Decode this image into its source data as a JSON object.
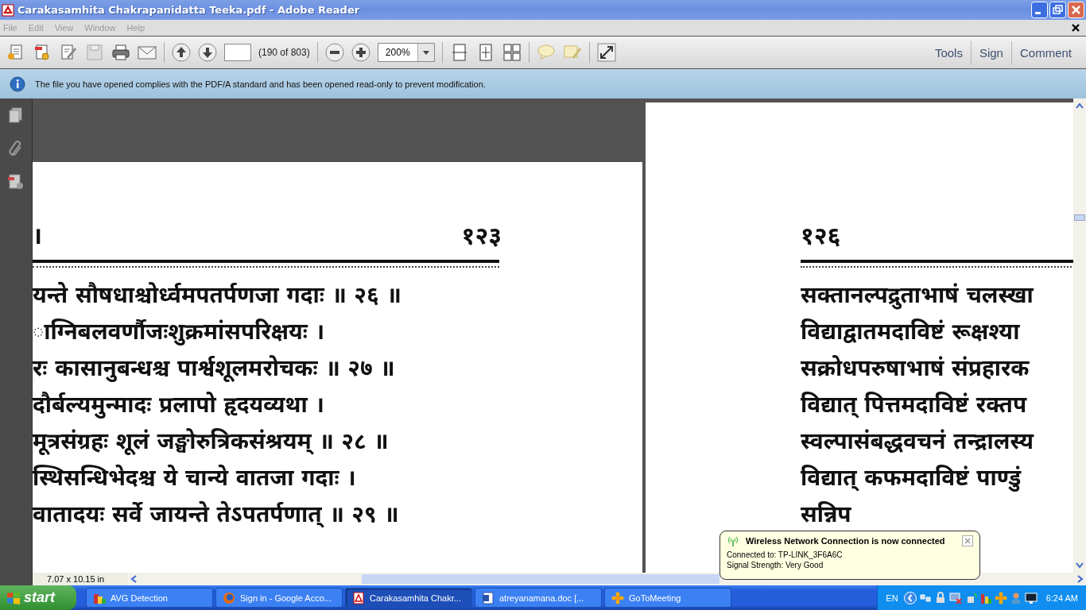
{
  "window": {
    "title": "Carakasamhita Chakrapanidatta Teeka.pdf - Adobe Reader"
  },
  "menu": [
    "File",
    "Edit",
    "View",
    "Window",
    "Help"
  ],
  "toolbar": {
    "page_count": "(190 of 803)",
    "zoom": "200%",
    "panels": [
      "Tools",
      "Sign",
      "Comment"
    ]
  },
  "info_bar": "The file you have opened complies with the PDF/A standard and has been opened read-only to prevent modification.",
  "pages": [
    {
      "header_left": "।",
      "page_number": "१२३",
      "lines": [
        "यन्ते सौषधाश्चोर्ध्वमपतर्पणजा गदाः ॥ २६ ॥",
        "ाग्निबलवर्णौजःशुक्रमांसपरिक्षयः ।",
        "रः कासानुबन्धश्च पार्श्वशूलमरोचकः ॥ २७ ॥",
        "दौर्बल्यमुन्मादः प्रलापो हृदयव्यथा ।",
        "मूत्रसंग्रहः शूलं जङ्घोरुत्रिकसंश्रयम् ॥ २८ ॥",
        "स्थिसन्धिभेदश्च ये चान्ये वातजा गदाः ।",
        "वातादयः सर्वे जायन्ते तेऽपतर्पणात् ॥ २९ ॥"
      ]
    },
    {
      "page_number": "१२६",
      "lines": [
        "सक्तानल्पद्रुताभाषं चलस्खा",
        "विद्याद्वातमदाविष्टं रूक्षश्या",
        "सक्रोधपरुषाभाषं संप्रहारक",
        "विद्यात् पित्तमदाविष्टं रक्तप",
        "स्वल्पासंबद्धवचनं तन्द्रालस्य",
        "विद्यात् कफमदाविष्टं पाण्डुं",
        "सन्निप"
      ]
    }
  ],
  "page_size": "7.07 x 10.15 in",
  "notification": {
    "title": "Wireless Network Connection is now connected",
    "lines": [
      "Connected to: TP-LINK_3F6A6C",
      "Signal Strength: Very Good"
    ]
  },
  "taskbar": {
    "start": "start",
    "tasks": [
      {
        "label": "AVG Detection",
        "selected": false
      },
      {
        "label": "Sign in - Google Acco...",
        "selected": false
      },
      {
        "label": "Carakasamhita Chakr...",
        "selected": true
      },
      {
        "label": "atreyanamana.doc [...",
        "selected": false
      },
      {
        "label": "GoToMeeting",
        "selected": false
      }
    ],
    "language": "EN",
    "clock": "6:24 AM"
  }
}
